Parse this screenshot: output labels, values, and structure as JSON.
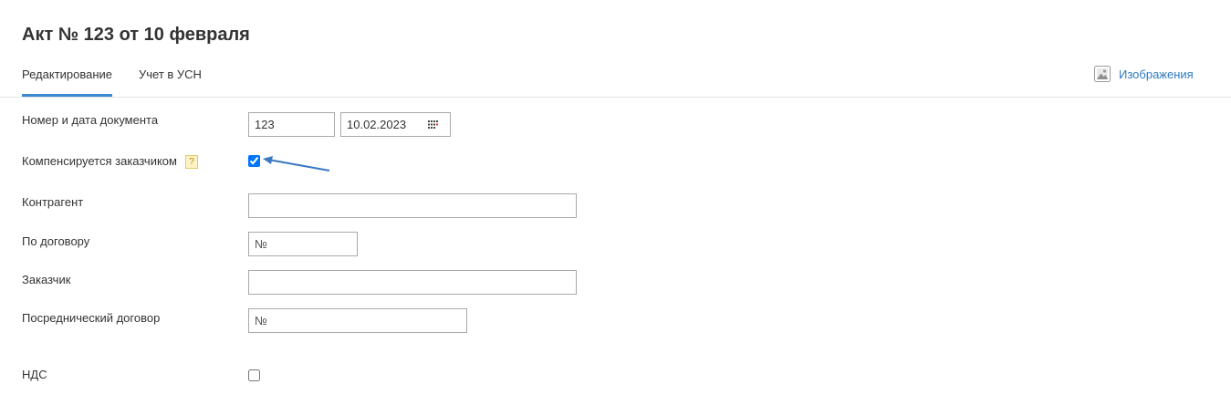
{
  "page": {
    "title": "Акт № 123 от 10 февраля"
  },
  "tabs": [
    {
      "label": "Редактирование",
      "active": true
    },
    {
      "label": "Учет в УСН",
      "active": false
    }
  ],
  "images_link": {
    "label": "Изображения",
    "icon": "image-icon"
  },
  "form": {
    "doc_number_date": {
      "label": "Номер и дата документа",
      "number_value": "123",
      "date_value": "10.02.2023",
      "icon": "calendar-icon"
    },
    "compensated": {
      "label": "Компенсируется заказчиком",
      "help": "?",
      "checked": true
    },
    "counterparty": {
      "label": "Контрагент",
      "value": ""
    },
    "contract": {
      "label": "По договору",
      "placeholder": "№"
    },
    "customer": {
      "label": "Заказчик",
      "value": ""
    },
    "agency_contract": {
      "label": "Посреднический договор",
      "placeholder": "№"
    },
    "vat": {
      "label": "НДС",
      "checked": false
    }
  },
  "colors": {
    "accent": "#3d8ad1",
    "link": "#2e7bc4",
    "arrow": "#3b78c2"
  }
}
